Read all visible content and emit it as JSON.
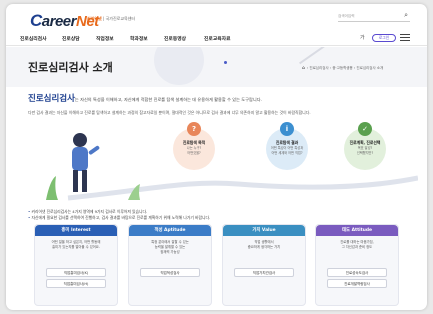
{
  "header": {
    "logo_prefix": "C",
    "logo_mid": "areer",
    "logo_net": "Net",
    "sub_brand_accent": "커리어넷",
    "sub_brand_rest": " | 국가진로교육센터",
    "search_placeholder": "검색어입력",
    "search_icon": "magnifier",
    "login_label": "로그인"
  },
  "nav": {
    "items": [
      "진로심리검사",
      "진로상담",
      "직업정보",
      "학과정보",
      "진로동영상",
      "진로교육자료"
    ],
    "util_label": "가"
  },
  "title_band": {
    "title": "진로심리검사 소개",
    "home_icon": "home",
    "breadcrumb": "› 진로심리검사 › 중·고등학생용 › 진로심리검사 소개"
  },
  "intro": {
    "highlight": "진로심리검사",
    "line1_rest": "는 자신의 특성을 이해하고, 자신에게 적합한 진로를 탐색 설계하는 데 유용하게 활용할 수 있는 도구랍니다.",
    "line2": "다만 검사 결과는 자신을 이해하고 진로를 탐색하고 설계하는 과정의 참고자료일 뿐이며, 절대적인 것은 아니므로 검사 결과에 너무 의존하지 말고 활용하는 것이 바람직합니다."
  },
  "bubbles": [
    {
      "title": "진로탐색 목적",
      "desc": "나는 누구?\n어떤것을?",
      "color": "#e8865a",
      "bg": "#fbe7dc",
      "icon": "?"
    },
    {
      "title": "진로탐색 결과",
      "desc": "어떤 특성이 어떤 특성과\n어떤 세계와 어떤 직업?",
      "color": "#3c8fd0",
      "bg": "#dcebf7",
      "icon": "i"
    },
    {
      "title": "진로계획, 진로선택",
      "desc": "목표 달성?\n선택했지만?",
      "color": "#5aa04e",
      "bg": "#e2f0dc",
      "icon": "✓"
    }
  ],
  "notes": [
    "커리어넷 진로심리검사는 4가지 영역에 9가지 검사로 이루어져 있습니다.",
    "자신에게 필요한 검사를 선택하여 진행하고, 검사 결과를 바탕으로 진로를 계획하기 위해 노력해 나가기 바랍니다."
  ],
  "cards": [
    {
      "head": "흥미 Interest",
      "color": "#2a5fb5",
      "desc": "어떤 일을 하고 싶은지, 어떤 활동에\n흥미가 있는지를 알아볼 수 있어요.\n",
      "buttons": [
        "직업흥미검사(K)",
        "직업흥미검사(H)"
      ]
    },
    {
      "head": "적성 Aptitude",
      "color": "#3b7cc7",
      "desc": "특정 분야에서 잘할 수 있는\n능력을 발휘할 수 있는\n잠재력 가능성",
      "buttons": [
        "직업적성검사"
      ]
    },
    {
      "head": "가치 Value",
      "color": "#3a8fc1",
      "desc": "직업 생활에서\n중요하게 생각하는 가치",
      "buttons": [
        "직업가치관검사"
      ]
    },
    {
      "head": "태도 Attitude",
      "color": "#7a5bbf",
      "desc": "진로를 대하는 마음가짐,\n그 자신감과 준비 정도",
      "buttons": [
        "진로성숙도검사",
        "진로개발역량검사"
      ]
    }
  ]
}
